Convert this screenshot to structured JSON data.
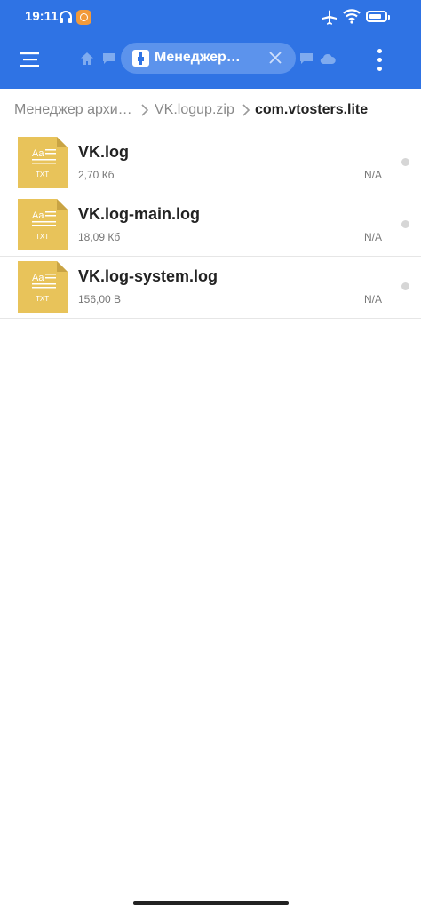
{
  "status": {
    "time": "19:11"
  },
  "header": {
    "active_tab_label": "Менеджер…",
    "icons": [
      "menu-icon",
      "home-icon",
      "chat-icon",
      "archive-icon",
      "close-icon",
      "chat-icon",
      "cloud-icon",
      "more-vert-icon"
    ]
  },
  "breadcrumb": {
    "items": [
      "Менеджер архи…",
      "VK.logup.zip",
      "com.vtosters.lite"
    ]
  },
  "files": [
    {
      "name": "VK.log",
      "size": "2,70 Кб",
      "date": "N/A",
      "icon_top": "Aa",
      "icon_ext": "TXT"
    },
    {
      "name": "VK.log-main.log",
      "size": "18,09 Кб",
      "date": "N/A",
      "icon_top": "Aa",
      "icon_ext": "TXT"
    },
    {
      "name": "VK.log-system.log",
      "size": "156,00 B",
      "date": "N/A",
      "icon_top": "Aa",
      "icon_ext": "TXT"
    }
  ],
  "colors": {
    "accent": "#2f73e4",
    "tab_active": "#5c93ec",
    "file_icon": "#e8c35a"
  }
}
